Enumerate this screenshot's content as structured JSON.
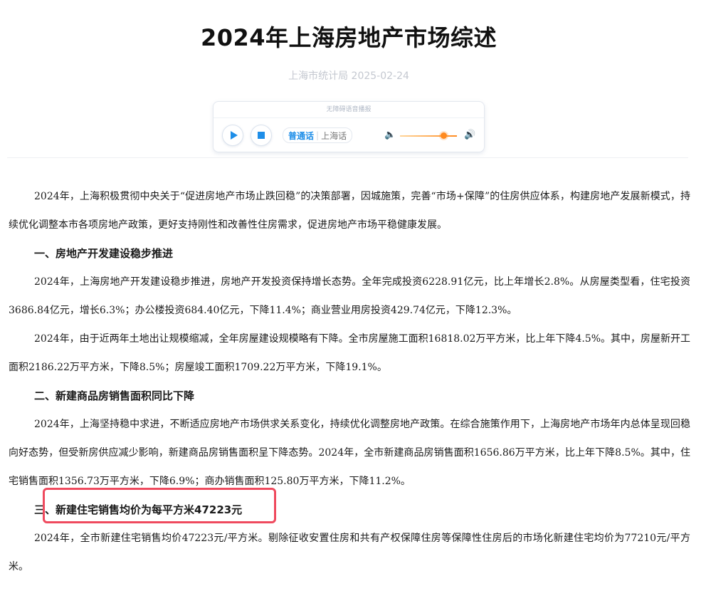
{
  "article": {
    "title": "2024年上海房地产市场综述",
    "source": "上海市统计局 2025-02-24"
  },
  "player": {
    "header": "无障碍语音播报",
    "play_icon": "play-icon",
    "stop_icon": "stop-icon",
    "lang_active": "普通话",
    "lang_inactive": "上海话",
    "volume_icon": "speaker-icon",
    "volume_level": 0.76
  },
  "paragraphs": [
    "2024年，上海积极贯彻中央关于“促进房地产市场止跌回稳”的决策部署，因城施策，完善“市场+保障”的住房供应体系，构建房地产发展新模式，持续优化调整本市各项房地产政策，更好支持刚性和改善性住房需求，促进房地产市场平稳健康发展。",
    "一、房地产开发建设稳步推进",
    "2024年，上海房地产开发建设稳步推进，房地产开发投资保持增长态势。全年完成投资6228.91亿元，比上年增长2.8%。从房屋类型看，住宅投资3686.84亿元，增长6.3%；办公楼投资684.40亿元，下降11.4%；商业营业用房投资429.74亿元，下降12.3%。",
    "2024年，由于近两年土地出让规模缩减，全年房屋建设规模略有下降。全市房屋施工面积16818.02万平方米，比上年下降4.5%。其中，房屋新开工面积2186.22万平方米，下降8.5%；房屋竣工面积1709.22万平方米，下降19.1%。",
    "二、新建商品房销售面积同比下降",
    "2024年，上海坚持稳中求进，不断适应房地产市场供求关系变化，持续优化调整房地产政策。在综合施策作用下，上海房地产市场年内总体呈现回稳向好态势，但受新房供应减少影响，新建商品房销售面积呈下降态势。2024年，全市新建商品房销售面积1656.86万平方米，比上年下降8.5%。其中，住宅销售面积1356.73万平方米，下降6.9%；商办销售面积125.80万平方米，下降11.2%。",
    "三、新建住宅销售均价为每平方米47223元",
    "2024年，全市新建住宅销售均价47223元/平方米。剔除征收安置住房和共有产权保障住房等保障性住房后的市场化新建住宅均价为77210元/平方米。"
  ],
  "colors": {
    "accent": "#1e8ee8",
    "highlight": "#ef4a5e",
    "volume": "#ff8a1f"
  }
}
